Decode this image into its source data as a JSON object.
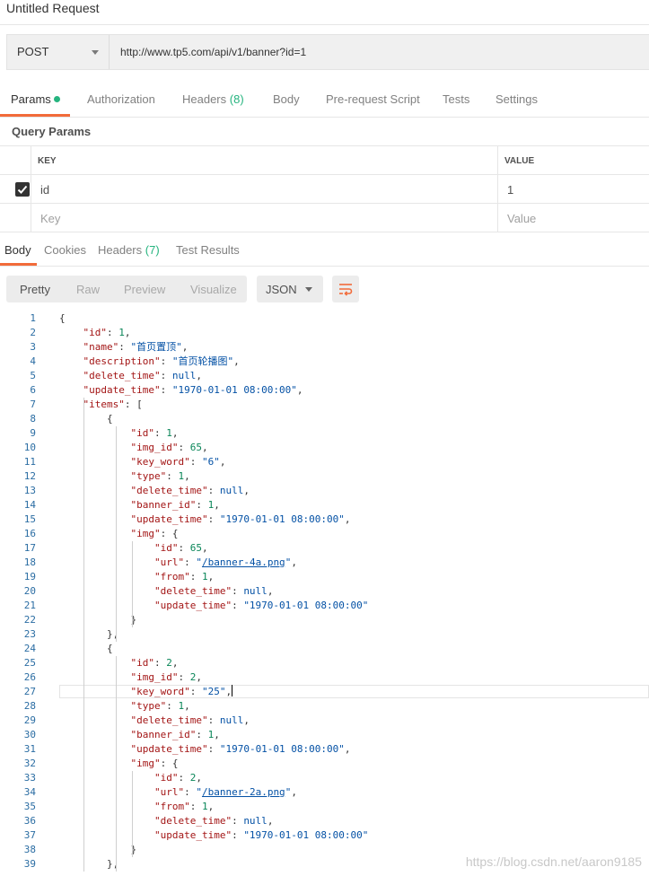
{
  "title": "Untitled Request",
  "request": {
    "method": "POST",
    "url": "http://www.tp5.com/api/v1/banner?id=1"
  },
  "tabs": {
    "params": "Params",
    "authorization": "Authorization",
    "headers": "Headers",
    "headers_count": "(8)",
    "body": "Body",
    "prerequest": "Pre-request Script",
    "tests": "Tests",
    "settings": "Settings"
  },
  "query_params": {
    "title": "Query Params",
    "col_key": "KEY",
    "col_value": "VALUE",
    "rows": [
      {
        "key": "id",
        "value": "1",
        "checked": true
      }
    ],
    "placeholder_key": "Key",
    "placeholder_value": "Value"
  },
  "response_tabs": {
    "body": "Body",
    "cookies": "Cookies",
    "headers": "Headers",
    "headers_count": "(7)",
    "test_results": "Test Results"
  },
  "view_modes": [
    "Pretty",
    "Raw",
    "Preview",
    "Visualize"
  ],
  "active_view": "Pretty",
  "format": "JSON",
  "colors": {
    "accent": "#f26b3a",
    "count": "#26b47f",
    "line_numbers": "#2b6da3"
  },
  "code_lines": [
    "{",
    "    \"id\": 1,",
    "    \"name\": \"首页置顶\",",
    "    \"description\": \"首页轮播图\",",
    "    \"delete_time\": null,",
    "    \"update_time\": \"1970-01-01 08:00:00\",",
    "    \"items\": [",
    "        {",
    "            \"id\": 1,",
    "            \"img_id\": 65,",
    "            \"key_word\": \"6\",",
    "            \"type\": 1,",
    "            \"delete_time\": null,",
    "            \"banner_id\": 1,",
    "            \"update_time\": \"1970-01-01 08:00:00\",",
    "            \"img\": {",
    "                \"id\": 65,",
    "                \"url\": \"/banner-4a.png\",",
    "                \"from\": 1,",
    "                \"delete_time\": null,",
    "                \"update_time\": \"1970-01-01 08:00:00\"",
    "            }",
    "        },",
    "        {",
    "            \"id\": 2,",
    "            \"img_id\": 2,",
    "            \"key_word\": \"25\",",
    "            \"type\": 1,",
    "            \"delete_time\": null,",
    "            \"banner_id\": 1,",
    "            \"update_time\": \"1970-01-01 08:00:00\",",
    "            \"img\": {",
    "                \"id\": 2,",
    "                \"url\": \"/banner-2a.png\",",
    "                \"from\": 1,",
    "                \"delete_time\": null,",
    "                \"update_time\": \"1970-01-01 08:00:00\"",
    "            }",
    "        },"
  ],
  "current_line": 27,
  "watermark": "https://blog.csdn.net/aaron9185"
}
